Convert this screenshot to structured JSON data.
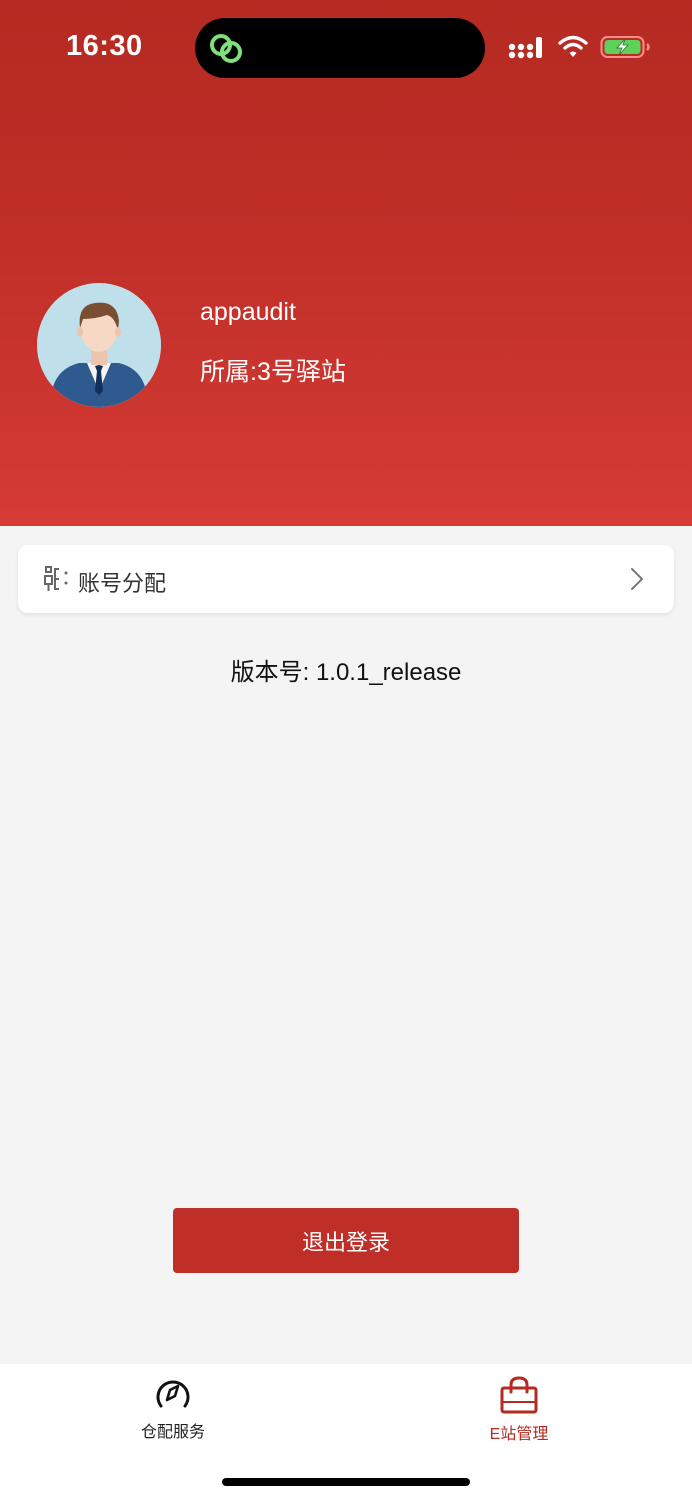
{
  "status_bar": {
    "time": "16:30",
    "icons": [
      "cellular-signal-icon",
      "wifi-icon",
      "battery-charging-icon"
    ],
    "island_app_icon": "link-icon"
  },
  "profile": {
    "username": "appaudit",
    "affiliation": "所属:3号驿站",
    "avatar_icon": "user-avatar"
  },
  "menu": {
    "items": [
      {
        "label": "账号分配",
        "icon": "account-assign-icon",
        "trailing_icon": "chevron-right-icon"
      }
    ]
  },
  "version_text": "版本号: 1.0.1_release",
  "logout_label": "退出登录",
  "tabbar": {
    "tabs": [
      {
        "label": "仓配服务",
        "icon": "compass-icon",
        "active": false
      },
      {
        "label": "E站管理",
        "icon": "shopping-bag-icon",
        "active": true
      }
    ]
  },
  "colors": {
    "header_top": "#b52a22",
    "header_bottom": "#d63b35",
    "accent": "#bf2f28",
    "background": "#f4f4f4"
  }
}
